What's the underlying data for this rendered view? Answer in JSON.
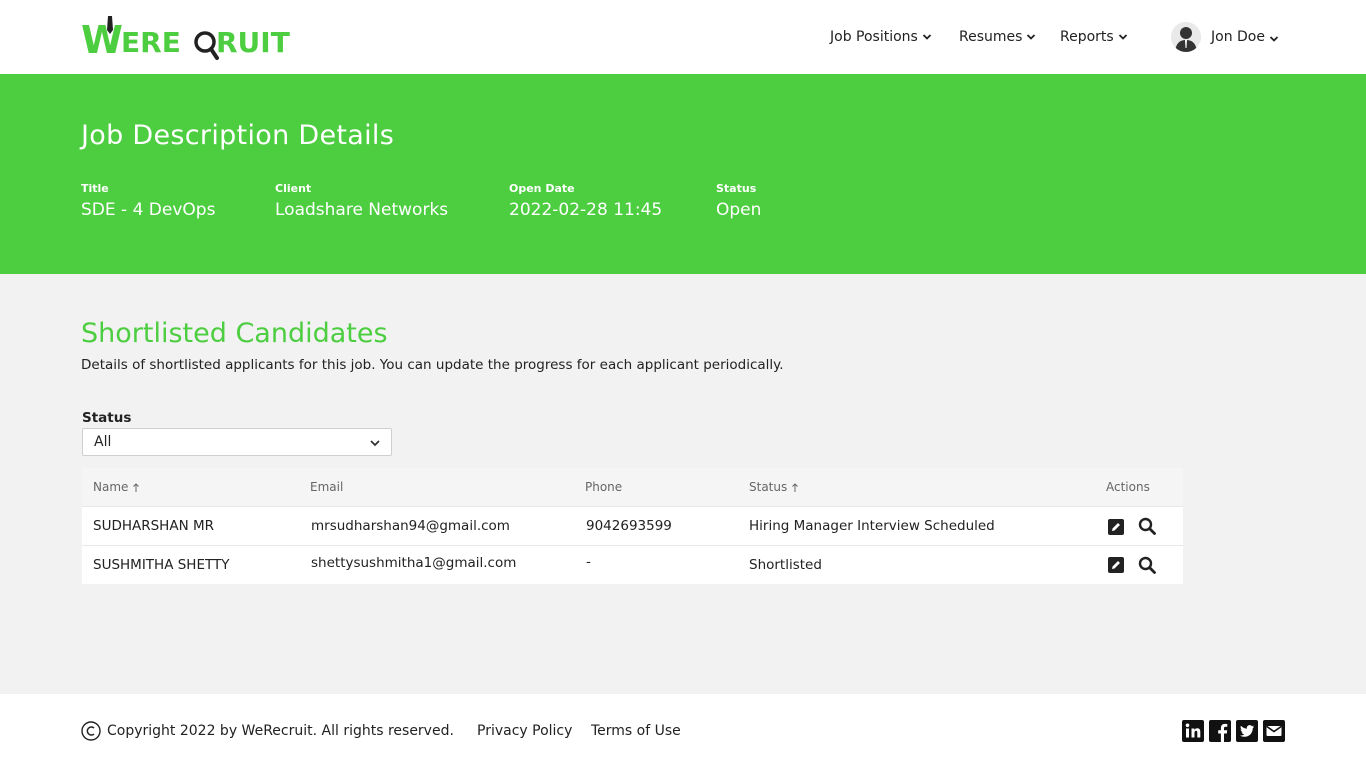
{
  "brand": {
    "logo_text": "WeRecruit",
    "accent": "#4dcd40",
    "dark": "#222222"
  },
  "nav": {
    "items": [
      {
        "label": "Job Positions",
        "icon": "chevron-down-icon"
      },
      {
        "label": "Resumes",
        "icon": "chevron-down-icon"
      },
      {
        "label": "Reports",
        "icon": "chevron-down-icon"
      }
    ],
    "user": {
      "name": "Jon Doe",
      "icon": "chevron-down-icon"
    }
  },
  "banner": {
    "title": "Job Description Details",
    "fields": [
      {
        "label": "Title",
        "value": "SDE - 4 DevOps"
      },
      {
        "label": "Client",
        "value": "Loadshare Networks"
      },
      {
        "label": "Open Date",
        "value": "2022-02-28 11:45"
      },
      {
        "label": "Status",
        "value": "Open"
      }
    ]
  },
  "section": {
    "title": "Shortlisted Candidates",
    "description": "Details of shortlisted applicants for this job. You can update the progress for each applicant periodically."
  },
  "filter": {
    "label": "Status",
    "selected": "All"
  },
  "table": {
    "columns": [
      {
        "label": "Name",
        "sortable": true
      },
      {
        "label": "Email",
        "sortable": false
      },
      {
        "label": "Phone",
        "sortable": false
      },
      {
        "label": "Status",
        "sortable": true
      },
      {
        "label": "Actions",
        "sortable": false
      }
    ],
    "rows": [
      {
        "name": "SUDHARSHAN MR",
        "email": "mrsudharshan94@gmail.com",
        "phone": "9042693599",
        "status": "Hiring Manager Interview Scheduled",
        "actions": [
          "edit-icon",
          "search-icon"
        ]
      },
      {
        "name": "SUSHMITHA SHETTY",
        "email": "shettysushmitha1@gmail.com",
        "phone": "-",
        "status": "Shortlisted",
        "actions": [
          "edit-icon",
          "search-icon"
        ]
      }
    ]
  },
  "footer": {
    "copyright": "Copyright 2022 by WeRecruit. All rights reserved.",
    "links": [
      "Privacy Policy",
      "Terms of Use"
    ],
    "social": [
      "linkedin-icon",
      "facebook-icon",
      "twitter-icon",
      "email-icon"
    ]
  }
}
